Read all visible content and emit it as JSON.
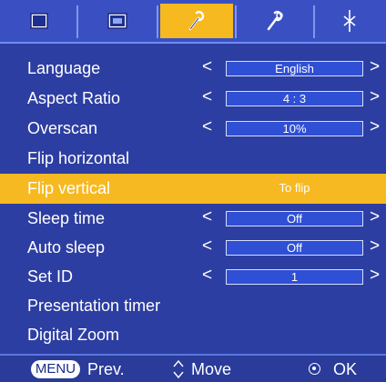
{
  "tabs": [
    {
      "icon": "picture-icon",
      "active": false
    },
    {
      "icon": "screen-icon",
      "active": false
    },
    {
      "icon": "wrench-icon",
      "active": true
    },
    {
      "icon": "tools-icon",
      "active": false
    },
    {
      "icon": "input-icon",
      "active": false
    }
  ],
  "menu": [
    {
      "label": "Language",
      "value": "English"
    },
    {
      "label": "Aspect Ratio",
      "value": "4 : 3"
    },
    {
      "label": "Overscan",
      "value": "10%"
    },
    {
      "label": "Flip horizontal"
    },
    {
      "label": "Flip vertical",
      "value": "To flip",
      "selected": true
    },
    {
      "label": "Sleep time",
      "value": "Off"
    },
    {
      "label": "Auto sleep",
      "value": "Off"
    },
    {
      "label": "Set ID",
      "value": "1"
    },
    {
      "label": "Presentation timer"
    },
    {
      "label": "Digital Zoom"
    }
  ],
  "arrows": {
    "left": "<",
    "right": ">"
  },
  "footer": {
    "menu_key": "MENU",
    "prev_label": "Prev.",
    "move_label": "Move",
    "ok_label": "OK"
  },
  "colors": {
    "background": "#2d3ea2",
    "highlight": "#f6b91f",
    "value_box": "#2f4fd4"
  }
}
